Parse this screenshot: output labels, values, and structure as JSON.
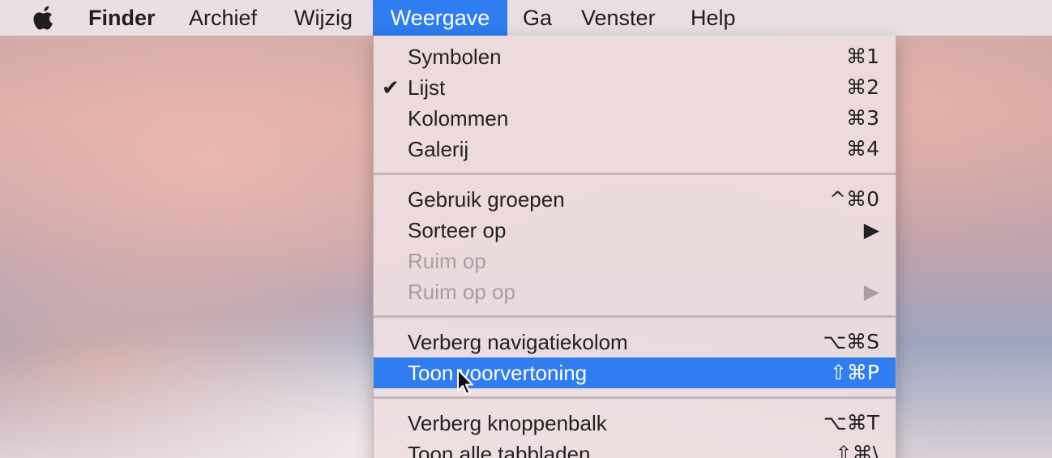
{
  "menubar": {
    "apple_icon": "apple-icon",
    "items": [
      {
        "label": "Finder"
      },
      {
        "label": "Archief"
      },
      {
        "label": "Wijzig"
      },
      {
        "label": "Weergave"
      },
      {
        "label": "Ga"
      },
      {
        "label": "Venster"
      },
      {
        "label": "Help"
      }
    ],
    "active_item": "Weergave"
  },
  "menu": {
    "items": [
      {
        "label": "Symbolen",
        "shortcut": "⌘1"
      },
      {
        "label": "Lijst",
        "shortcut": "⌘2",
        "check": "✔"
      },
      {
        "label": "Kolommen",
        "shortcut": "⌘3"
      },
      {
        "label": "Galerij",
        "shortcut": "⌘4"
      },
      {
        "label": "Gebruik groepen",
        "shortcut": "^⌘0"
      },
      {
        "label": "Sorteer op",
        "shortcut": "▶"
      },
      {
        "label": "Ruim op",
        "shortcut": ""
      },
      {
        "label": "Ruim op op",
        "shortcut": "▶"
      },
      {
        "label": "Verberg navigatiekolom",
        "shortcut": "⌥⌘S"
      },
      {
        "label": "Toon voorvertoning",
        "shortcut": "⇧⌘P"
      },
      {
        "label": "Verberg knoppenbalk",
        "shortcut": "⌥⌘T"
      },
      {
        "label": "Toon alle tabbladen",
        "shortcut": "⇧⌘\\"
      }
    ],
    "highlighted_item": "Toon voorvertoning",
    "disabled_items": [
      "Ruim op",
      "Ruim op op"
    ]
  },
  "colors": {
    "highlight": "#2f7df0",
    "menu_background": "#eedee0",
    "disabled_text": "#a89ea0"
  }
}
